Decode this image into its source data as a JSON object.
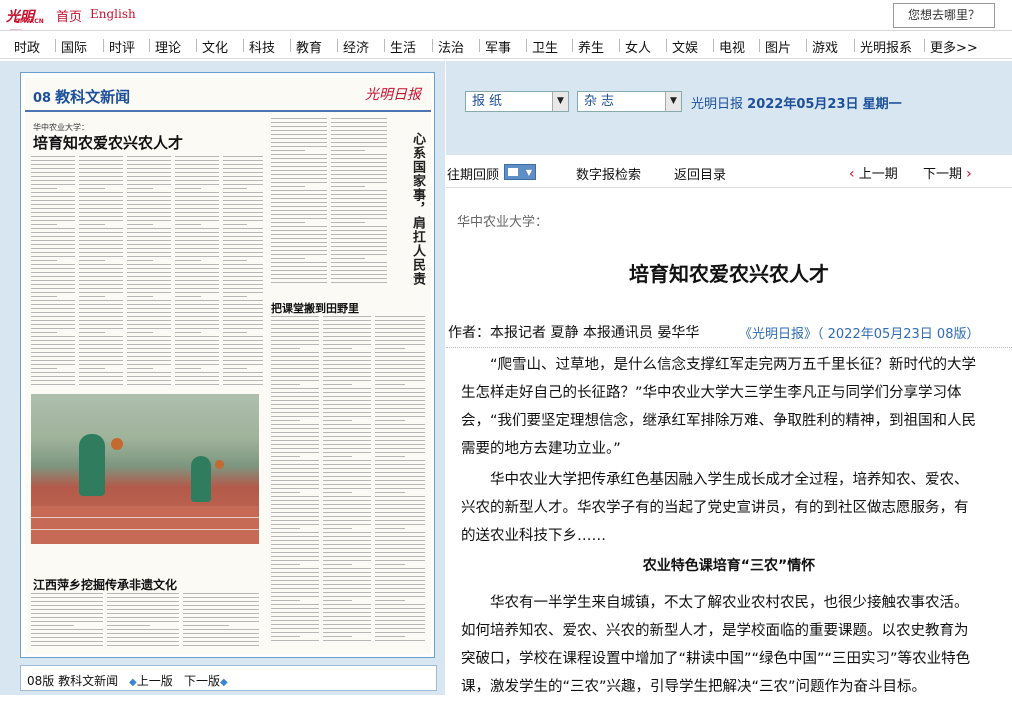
{
  "topbar": {
    "logo_text": "光明网",
    "logo_sub": "GMW.CN",
    "home": "首页",
    "english": "English",
    "where_button": "您想去哪里？"
  },
  "nav": [
    "时政",
    "国际",
    "时评",
    "理论",
    "文化",
    "科技",
    "教育",
    "经济",
    "生活",
    "法治",
    "军事",
    "卫生",
    "养生",
    "女人",
    "文娱",
    "电视",
    "图片",
    "游戏",
    "光明报系",
    "更多>>"
  ],
  "paper": {
    "edition_num": "08",
    "edition_name": "教科文新闻",
    "masthead": "光明日报",
    "kicker": "华中农业大学：",
    "title": "培育知农爱农兴农人才",
    "vertical_title": "心系国家事，肩扛人民责",
    "headline_bottom": "江西萍乡挖掘传承非遗文化",
    "headline_right": "把课堂搬到田野里"
  },
  "pager": {
    "label": "08版 教科文新闻",
    "prev": "上一版",
    "next": "下一版"
  },
  "selectors": {
    "newspaper": "报纸",
    "magazine": "杂志"
  },
  "dateline": {
    "paper": "光明日报",
    "date": "2022年05月23日",
    "weekday": "星期一"
  },
  "toolbar": {
    "review": "往期回顾",
    "digital_search": "数字报检索",
    "back_to_index": "返回目录",
    "prev_page": "上一期",
    "next_page": "下一期"
  },
  "article": {
    "kicker": "华中农业大学：",
    "title": "培育知农爱农兴农人才",
    "byline": "作者：本报记者 夏静 本报通讯员 晏华华",
    "source": "《光明日报》（ 2022年05月23日 08版）",
    "p1": "“爬雪山、过草地，是什么信念支撑红军走完两万五千里长征？新时代的大学生怎样走好自己的长征路？”华中农业大学大三学生李凡正与同学们分享学习体会，“我们要坚定理想信念，继承红军排除万难、争取胜利的精神，到祖国和人民需要的地方去建功立业。”",
    "p2": "华中农业大学把传承红色基因融入学生成长成才全过程，培养知农、爱农、兴农的新型人才。华农学子有的当起了党史宣讲员，有的到社区做志愿服务，有的送农业科技下乡……",
    "subhead": "农业特色课培育“三农”情怀",
    "p3": "华农有一半学生来自城镇，不太了解农业农村农民，也很少接触农事农活。如何培养知农、爱农、兴农的新型人才，是学校面临的重要课题。以农史教育为突破口，学校在课程设置中增加了“耕读中国”“绿色中国”“三田实习”等农业特色课，激发学生的“三农”兴趣，引导学生把解决“三农”问题作为奋斗目标。"
  },
  "colors": {
    "brand_red": "#c8102e",
    "link_blue": "#2f6bb7",
    "panel_blue": "#d8e6f1"
  }
}
